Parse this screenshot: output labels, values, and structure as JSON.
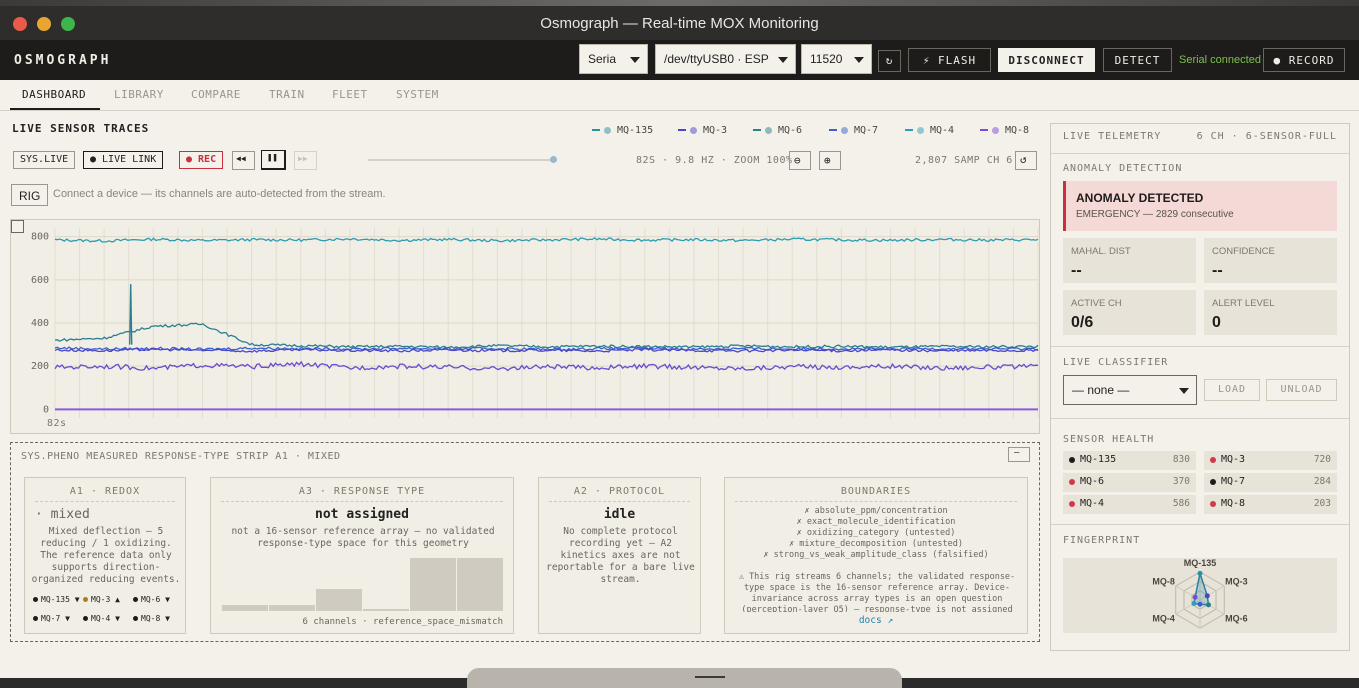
{
  "window": {
    "title": "Osmograph — Real-time MOX Monitoring"
  },
  "header": {
    "brand": "OSMOGRAPH",
    "transport_select": "Seria",
    "port_select": "/dev/ttyUSB0 · ESP",
    "baud_select": "11520",
    "refresh_icon": "refresh-icon",
    "flash_label": "⚡ FLASH",
    "disconnect_label": "DISCONNECT",
    "detect_label": "DETECT",
    "status_text": "Serial connected",
    "record_label": "● RECORD"
  },
  "tabs": [
    "DASHBOARD",
    "LIBRARY",
    "COMPARE",
    "TRAIN",
    "FLEET",
    "SYSTEM"
  ],
  "traces": {
    "title": "LIVE SENSOR TRACES",
    "legend": [
      {
        "label": "MQ-135",
        "color": "#2a8fa8"
      },
      {
        "label": "MQ-3",
        "color": "#4a46c8"
      },
      {
        "label": "MQ-6",
        "color": "#2a7f8f"
      },
      {
        "label": "MQ-7",
        "color": "#3a5fd0"
      },
      {
        "label": "MQ-4",
        "color": "#2aa0b8"
      },
      {
        "label": "MQ-8",
        "color": "#7a4ad8"
      }
    ],
    "sys_live": "SYS.LIVE",
    "live_link": "● LIVE LINK",
    "rec": "● REC",
    "rewind": "◀◀",
    "pause": "❚❚",
    "forward": "▶▶",
    "stats": "82S · 9.8 HZ · ZOOM 100%",
    "zoom_out": "⊖",
    "zoom_in": "⊕",
    "samples": "2,807 SAMP CH 6",
    "reset": "↺",
    "rig_label": "RIG",
    "rig_hint": "Connect a device — its channels are auto-detected from the stream.",
    "x_label": "82s"
  },
  "chart_data": {
    "type": "line",
    "yticks": [
      "800",
      "600",
      "400",
      "200",
      "0"
    ],
    "ylim": [
      -40,
      840
    ],
    "series": [
      {
        "name": "MQ-135",
        "color": "#2a9db0",
        "values": [
          785,
          780,
          788,
          782,
          786,
          784,
          790,
          783,
          787,
          781,
          785,
          789,
          784,
          786,
          782,
          788,
          785,
          783,
          787,
          784,
          786
        ]
      },
      {
        "name": "MQ-6",
        "color": "#2a7f8f",
        "values": [
          320,
          330,
          385,
          395,
          300,
          295,
          290,
          292,
          288,
          295,
          290,
          293,
          291,
          289,
          294,
          290,
          292,
          288,
          291,
          290,
          292
        ]
      },
      {
        "name": "MQ-7",
        "color": "#3a5fd0",
        "values": [
          285,
          280,
          282,
          278,
          284,
          281,
          279,
          283,
          280,
          282,
          278,
          281,
          283,
          279,
          282,
          280,
          281,
          279,
          282,
          280,
          281
        ]
      },
      {
        "name": "MQ-3",
        "color": "#4a46c8",
        "values": [
          275,
          272,
          278,
          274,
          270,
          276,
          273,
          271,
          275,
          272,
          274,
          270,
          276,
          273,
          271,
          274,
          272,
          275,
          271,
          273,
          272
        ]
      },
      {
        "name": "MQ-8",
        "color": "#6a4ad0",
        "values": [
          195,
          200,
          190,
          205,
          198,
          210,
          192,
          200,
          195,
          188,
          198,
          192,
          200,
          194,
          190,
          198,
          195,
          200,
          192,
          196,
          198
        ]
      },
      {
        "name": "MQ-4",
        "color": "#8a5ae0",
        "values": [
          0,
          0,
          0,
          0,
          0,
          0,
          0,
          0,
          0,
          0,
          0,
          0,
          0,
          0,
          0,
          0,
          0,
          0,
          0,
          0,
          0
        ]
      }
    ]
  },
  "pheno": {
    "header": "SYS.PHENO MEASURED RESPONSE-TYPE STRIP A1 · MIXED",
    "collapse": "—",
    "redox": {
      "title": "A1 · REDOX",
      "value": "· mixed",
      "desc": "Mixed deflection — 5 reducing / 1 oxidizing. The reference data only supports direction-organized reducing events.",
      "chips": [
        "MQ-135 ▼",
        "MQ-3 ▲",
        "MQ-6 ▼",
        "MQ-7 ▼",
        "MQ-4 ▼",
        "MQ-8 ▼"
      ]
    },
    "response": {
      "title": "A3 · RESPONSE TYPE",
      "value": "not assigned",
      "desc": "not a 16-sensor reference array — no validated response-type space for this geometry",
      "bars": [
        0.12,
        0.12,
        0.42,
        0.04,
        1.0,
        1.0
      ],
      "footer": "6 channels · reference_space_mismatch"
    },
    "protocol": {
      "title": "A2 · PROTOCOL",
      "value": "idle",
      "desc": "No complete protocol recording yet — A2 kinetics axes are not reportable for a bare live stream."
    },
    "boundaries": {
      "title": "BOUNDARIES",
      "items": [
        "✗ absolute_ppm/concentration",
        "✗ exact_molecule_identification",
        "✗ oxidizing_category (untested)",
        "✗ mixture_decomposition (untested)",
        "✗ strong_vs_weak_amplitude_class (falsified)"
      ],
      "note": "⚠ This rig streams 6 channels; the validated response-type space is the 16-sensor reference array. Device-invariance across array types is an open question (perception-layer Q5) — response-type is not assigned for this geometry.",
      "docs": "docs ↗"
    }
  },
  "telemetry": {
    "title": "LIVE TELEMETRY",
    "meta": "6 CH · 6-SENSOR-FULL",
    "anomaly_title": "ANOMALY DETECTION",
    "alert_head": "ANOMALY DETECTED",
    "alert_sub": "EMERGENCY — 2829 consecutive",
    "metrics": [
      {
        "k": "MAHAL. DIST",
        "v": "--"
      },
      {
        "k": "CONFIDENCE",
        "v": "--"
      },
      {
        "k": "ACTIVE CH",
        "v": "0/6"
      },
      {
        "k": "ALERT LEVEL",
        "v": "0"
      }
    ],
    "classifier_title": "LIVE CLASSIFIER",
    "classifier_select": "— none —",
    "load": "LOAD",
    "unload": "UNLOAD",
    "health_title": "SENSOR HEALTH",
    "health": [
      {
        "name": "MQ-135",
        "value": "830",
        "color": "#1d1c1a"
      },
      {
        "name": "MQ-3",
        "value": "720",
        "color": "#d03a4a"
      },
      {
        "name": "MQ-6",
        "value": "370",
        "color": "#d03a4a"
      },
      {
        "name": "MQ-7",
        "value": "284",
        "color": "#1d1c1a"
      },
      {
        "name": "MQ-4",
        "value": "586",
        "color": "#d03a4a"
      },
      {
        "name": "MQ-8",
        "value": "203",
        "color": "#d03a4a"
      }
    ],
    "fingerprint_title": "FINGERPRINT",
    "radar_labels": [
      "MQ-135",
      "MQ-3",
      "MQ-6",
      "MQ-7",
      "MQ-4",
      "MQ-8"
    ],
    "radar_values": [
      0.95,
      0.3,
      0.35,
      0.15,
      0.25,
      0.2
    ]
  }
}
